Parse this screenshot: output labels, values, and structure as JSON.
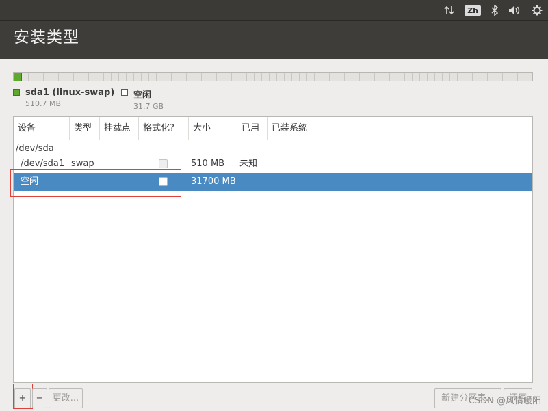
{
  "title": "安装类型",
  "tray": {
    "input_method": "Zh"
  },
  "legend": [
    {
      "name": "sda1 (linux-swap)",
      "size": "510.7 MB",
      "color": "#5faa2e"
    },
    {
      "name": "空闲",
      "size": "31.7 GB",
      "color": "#ffffff"
    }
  ],
  "partition_bar": {
    "used_fraction": 0.016
  },
  "table": {
    "columns": [
      "设备",
      "类型",
      "挂载点",
      "格式化?",
      "大小",
      "已用",
      "已装系统"
    ],
    "rows": [
      {
        "device": "/dev/sda",
        "type": "",
        "mount": "",
        "size": "",
        "used": "",
        "system": ""
      },
      {
        "device": " /dev/sda1",
        "type": "swap",
        "mount": "",
        "size": "510 MB",
        "used": "未知",
        "system": ""
      },
      {
        "device": "空闲",
        "type": "",
        "mount": "",
        "size": "31700 MB",
        "used": "",
        "system": "",
        "selected": true
      }
    ]
  },
  "toolbar": {
    "add_label": "+",
    "remove_label": "−",
    "change_label": "更改...",
    "new_table_label": "新建分区表...",
    "revert_label": "还原"
  },
  "watermark": "CSDN @风情暖阳",
  "colors": {
    "selection": "#4a8ac2",
    "swap_partition": "#5faa2e",
    "header": "#3e3d3a",
    "highlight_box": "#e0403a"
  }
}
